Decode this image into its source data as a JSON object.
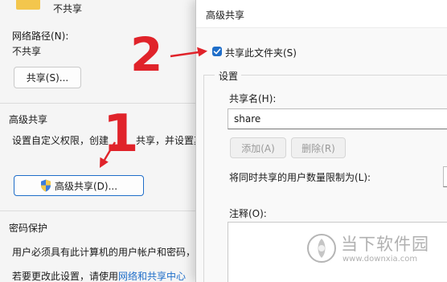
{
  "left": {
    "folder_status": "不共享",
    "network_path_label": "网络路径(N):",
    "network_path_value": "不共享",
    "share_button": "共享(S)...",
    "advanced_section_title": "高级共享",
    "advanced_desc": "设置自定义权限，创建",
    "advanced_desc_mid": "共享，并设置其",
    "advanced_button": "高级共享(D)...",
    "password_section_title": "密码保护",
    "password_desc": "用户必须具有此计算机的用户帐户和密码，",
    "password_note_prefix": "若要更改此设置，请使用",
    "password_note_link": "网络和共享中心"
  },
  "dialog": {
    "title": "高级共享",
    "share_checkbox_label": "共享此文件夹(S)",
    "share_checked": true,
    "settings_group": "设置",
    "share_name_label": "共享名(H):",
    "share_name_value": "share",
    "add_button": "添加(A)",
    "remove_button": "删除(R)",
    "user_limit_label": "将同时共享的用户数量限制为(L):",
    "comment_label": "注释(O):"
  },
  "annotations": {
    "step1": "1",
    "step2": "2",
    "accent_color": "#e0232a"
  },
  "watermark": {
    "cn": "当下软件园",
    "url": "www.downxia.com"
  },
  "colors": {
    "accent": "#1f6ec9",
    "annotation": "#e0232a"
  }
}
